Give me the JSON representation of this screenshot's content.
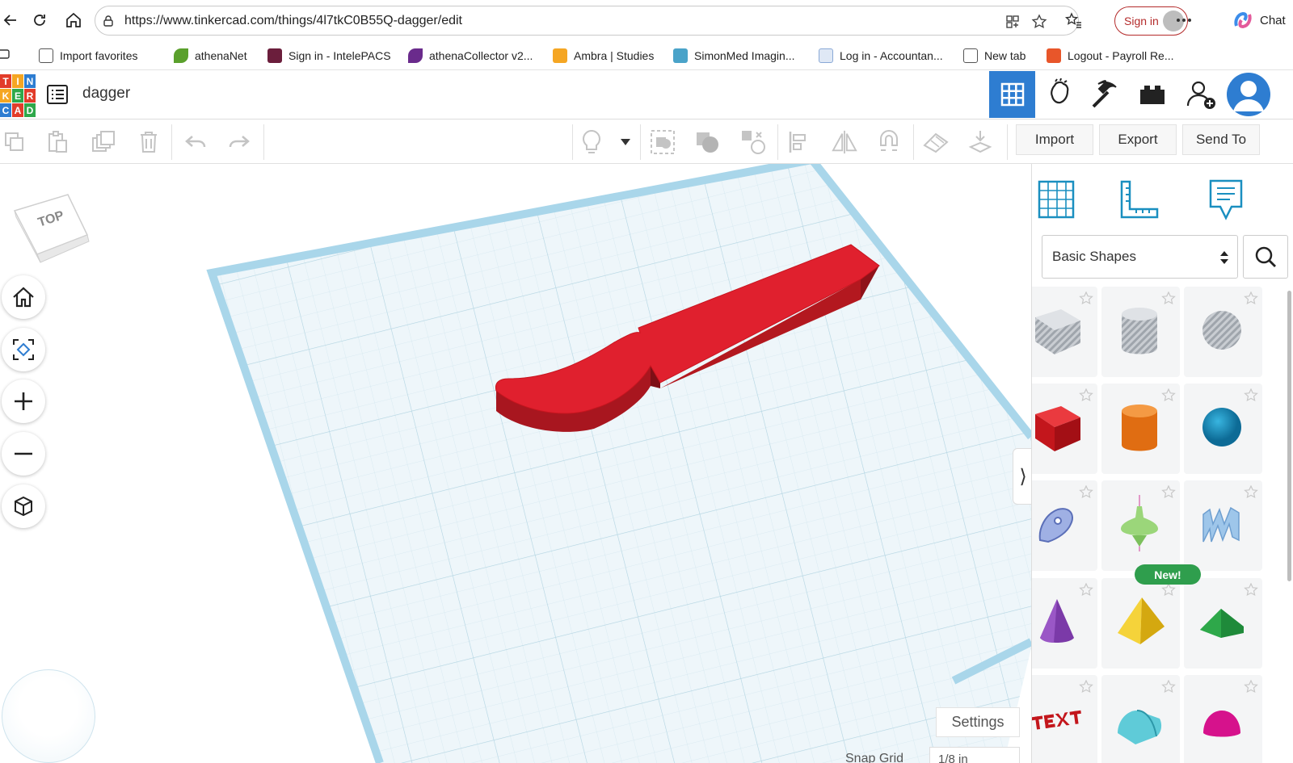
{
  "browser": {
    "url": "https://www.tinkercad.com/things/4l7tkC0B55Q-dagger/edit",
    "sign_in": "Sign in",
    "chat": "Chat"
  },
  "bookmarks": [
    {
      "label": "Import favorites",
      "color": "#555555"
    },
    {
      "label": "athenaNet",
      "color": "#5aa02c"
    },
    {
      "label": "Sign in - IntelePACS",
      "color": "#6b1e3c"
    },
    {
      "label": "athenaCollector v2...",
      "color": "#6a2b8c"
    },
    {
      "label": "Ambra | Studies",
      "color": "#f5a623"
    },
    {
      "label": "SimonMed Imagin...",
      "color": "#4aa3c9"
    },
    {
      "label": "Log in - Accountan...",
      "color": "#8aa9d6"
    },
    {
      "label": "New tab",
      "color": "#555555"
    },
    {
      "label": "Logout - Payroll Re...",
      "color": "#e8562a"
    }
  ],
  "app": {
    "logo_letters": [
      "T",
      "I",
      "N",
      "K",
      "E",
      "R",
      "C",
      "A",
      "D"
    ],
    "title": "dagger"
  },
  "toolbar": {
    "import": "Import",
    "export": "Export",
    "send_to": "Send To"
  },
  "viewcube": {
    "label": "TOP"
  },
  "workplane": {
    "settings": "Settings",
    "snap_grid_label": "Snap Grid",
    "snap_grid_value": "1/8 in"
  },
  "shapes_panel": {
    "category": "Basic Shapes",
    "new_badge": "New!",
    "shapes": [
      {
        "name": "box-hole",
        "color": "#b8bdc4"
      },
      {
        "name": "cylinder-hole",
        "color": "#b8bdc4"
      },
      {
        "name": "sphere-hole",
        "color": "#b8bdc4"
      },
      {
        "name": "box",
        "color": "#d0202a"
      },
      {
        "name": "cylinder",
        "color": "#e8761d"
      },
      {
        "name": "sphere",
        "color": "#1a8fc0"
      },
      {
        "name": "scribble",
        "color": "#8aa0d8"
      },
      {
        "name": "spinning-top",
        "color": "#9bd67a"
      },
      {
        "name": "wave-text",
        "color": "#8fb8e0"
      },
      {
        "name": "cone",
        "color": "#7b3aa8"
      },
      {
        "name": "pyramid",
        "color": "#f0c419"
      },
      {
        "name": "roof",
        "color": "#2ea84a"
      },
      {
        "name": "text",
        "color": "#d0202a"
      },
      {
        "name": "half-cylinder",
        "color": "#3fb8c8"
      },
      {
        "name": "half-sphere",
        "color": "#d6128c"
      }
    ]
  },
  "colors": {
    "accent": "#2E7DD1",
    "grid_bg": "#eef6fa",
    "model": "#e0202e"
  }
}
